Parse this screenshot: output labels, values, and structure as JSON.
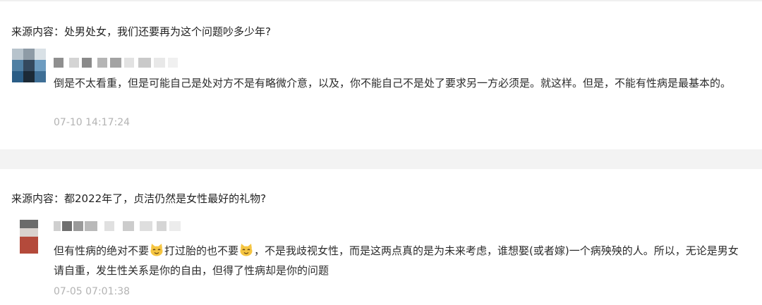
{
  "comments": [
    {
      "source_label": "来源内容：处男处女，我们还要再为这个问题吵多少年?",
      "body": "倒是不太看重，但是可能自己是处对方不是有略微介意，以及，你不能自己不是处了要求另一方必须是。就这样。但是，不能有性病是最基本的。",
      "timestamp": "07-10 14:17:24"
    },
    {
      "source_label": "来源内容：都2022年了，贞洁仍然是女性最好的礼物?",
      "body_part1": "但有性病的绝对不要",
      "body_part2": "打过胎的也不要",
      "body_part3": "，不是我歧视女性，而是这两点真的是为未来考虑，谁想娶(或者嫁)一个病殃殃的人。所以，无论是男女请自重，发生性关系是你的自由，但得了性病却是你的问题",
      "emoji_icon": "cat-face-icon",
      "timestamp": "07-05 07:01:38"
    }
  ],
  "colors": {
    "text": "#2b2b2b",
    "timestamp": "#b3b3b3",
    "separator": "#f3f3f3",
    "emoji_face": "#f5c542"
  }
}
